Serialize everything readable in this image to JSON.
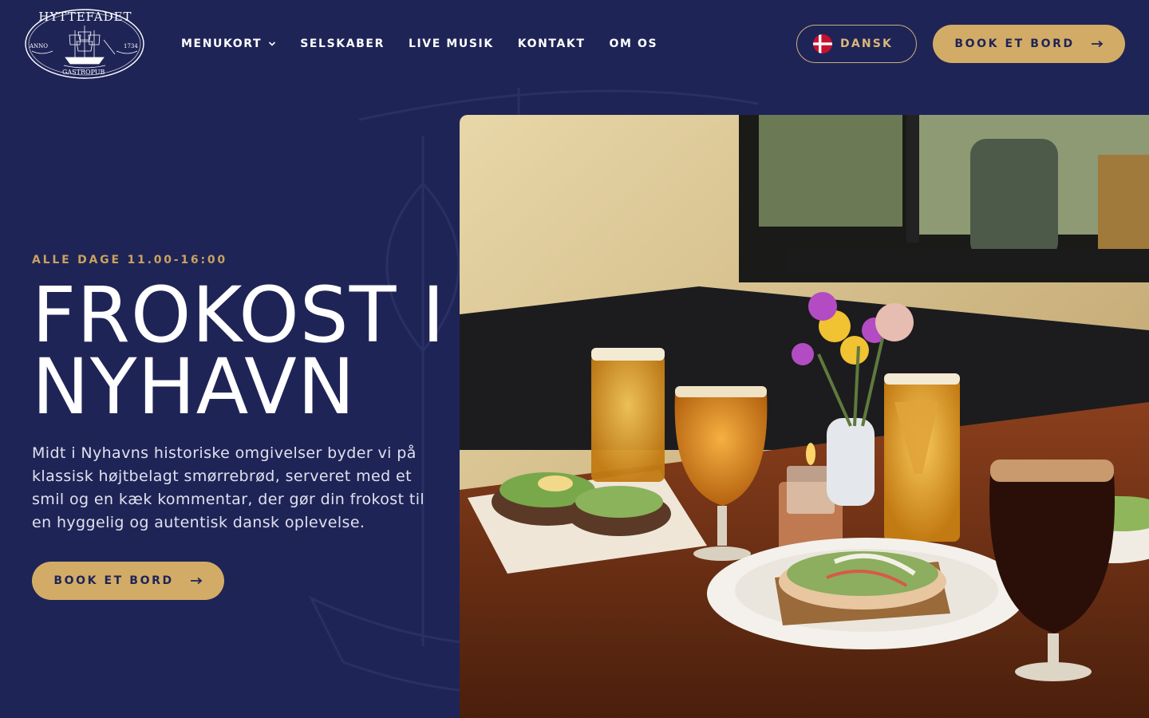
{
  "brand": {
    "name": "HYTTEFADET",
    "left_text": "ANNO",
    "right_text": "1734",
    "bottom_text": "GASTROPUB"
  },
  "nav": {
    "items": [
      {
        "label": "MENUKORT",
        "has_dropdown": true
      },
      {
        "label": "SELSKABER"
      },
      {
        "label": "LIVE MUSIK"
      },
      {
        "label": "KONTAKT"
      },
      {
        "label": "OM OS"
      }
    ]
  },
  "language": {
    "label": "DANSK",
    "flag": "denmark-flag-icon"
  },
  "header_cta": {
    "label": "BOOK ET BORD",
    "icon": "arrow-right-icon"
  },
  "hero": {
    "eyebrow": "ALLE DAGE 11.00-16:00",
    "title_line1": "FROKOST I",
    "title_line2": "NYHAVN",
    "intro": "Midt i Nyhavns historiske omgivelser byder vi på klassisk højtbelagt smørrebrød, serveret med et smil og en kæk kommentar, der gør din frokost til en hyggelig og autentisk dansk oplevelse.",
    "cta_label": "BOOK ET BORD",
    "image": "lunch-table-photo"
  },
  "colors": {
    "background": "#1f2457",
    "accent_gold": "#d2ac66",
    "eyebrow_gold": "#c9a25e",
    "text_white": "#ffffff"
  }
}
